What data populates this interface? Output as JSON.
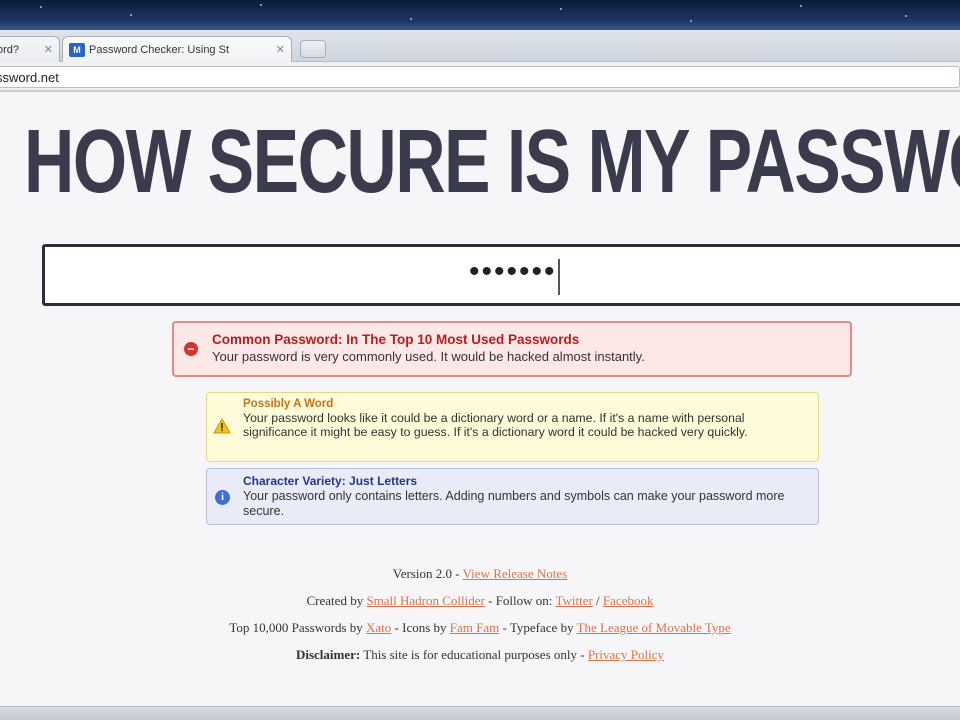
{
  "browser": {
    "tabs": [
      {
        "label": "ord?",
        "close": "✕"
      },
      {
        "label": "Password Checker: Using St",
        "close": "✕",
        "favicon": "M"
      }
    ],
    "url": "ssword.net"
  },
  "page": {
    "headline": "HOW SECURE IS MY PASSWORD",
    "password_value": "•••••••"
  },
  "alerts": {
    "common": {
      "title": "Common Password: In The Top 10 Most Used Passwords",
      "body": "Your password is very commonly used. It would be hacked almost instantly.",
      "icon": "minus-circle-icon",
      "icon_glyph": "−"
    },
    "word": {
      "title": "Possibly A Word",
      "body": "Your password looks like it could be a dictionary word or a name. If it's a name with personal significance it might be easy to guess. If it's a dictionary word it could be hacked very quickly.",
      "icon": "warning-icon"
    },
    "variety": {
      "title": "Character Variety: Just Letters",
      "body": "Your password only contains letters. Adding numbers and symbols can make your password more secure.",
      "icon": "info-icon",
      "icon_glyph": "i"
    }
  },
  "footer": {
    "version_text": "Version 2.0 - ",
    "release_notes": "View Release Notes",
    "created_by": "Created by ",
    "creator": "Small Hadron Collider",
    "follow_on": " - Follow on: ",
    "twitter": "Twitter",
    "slash": " / ",
    "facebook": "Facebook",
    "top_passwords": "Top 10,000 Passwords by ",
    "xato": "Xato",
    "icons_by": " - Icons by ",
    "famfam": "Fam Fam",
    "typeface_by": " - Typeface by ",
    "league": "The League of Movable Type",
    "disclaimer_label": "Disclaimer:",
    "disclaimer_text": " This site is for educational purposes only - ",
    "privacy": "Privacy Policy"
  },
  "colors": {
    "headline": "#3a3c4d",
    "link": "#d9734a",
    "error_title": "#b11f1f",
    "warning_title": "#c3731b",
    "info_title": "#24368c"
  }
}
